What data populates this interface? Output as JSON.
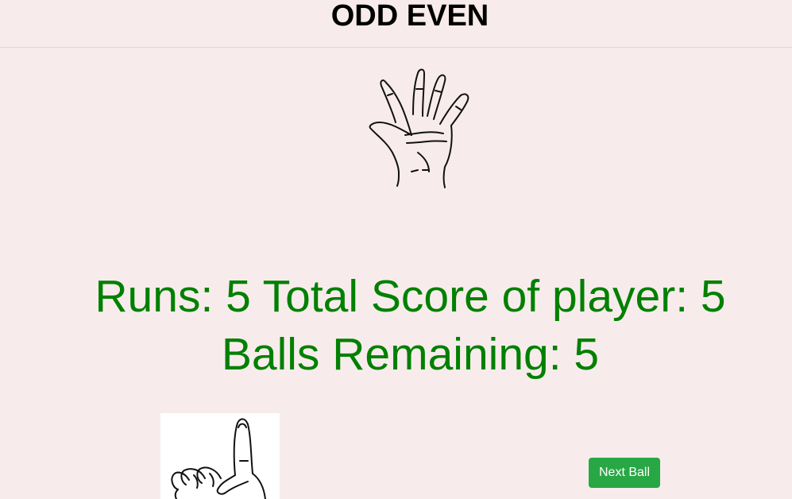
{
  "header": {
    "title": "ODD EVEN"
  },
  "images": {
    "top_hand_icon": "open-hand-five-fingers-icon",
    "bottom_hand_icon": "index-finger-one-icon"
  },
  "score": {
    "line1": "Runs: 5 Total Score of player: 5",
    "line2": "Balls Remaining: 5",
    "color": "#008000"
  },
  "actions": {
    "next_ball_label": "Next Ball",
    "button_color": "#28a745"
  },
  "theme": {
    "background": "#f7eceb"
  }
}
